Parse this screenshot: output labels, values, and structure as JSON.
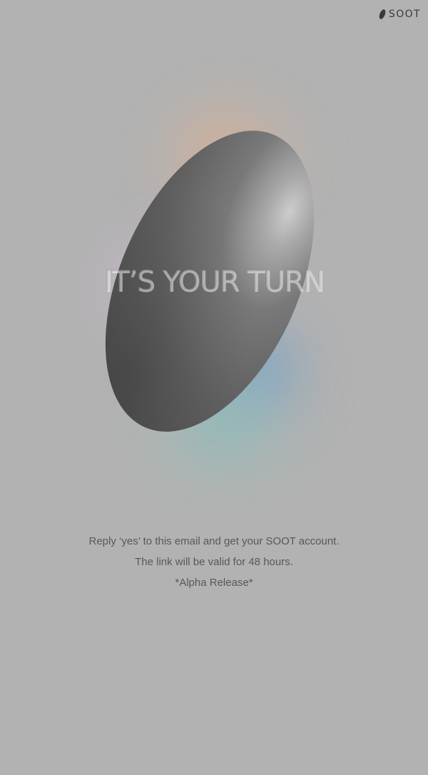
{
  "brand": {
    "name": "SOOT",
    "logo_icon": "soot-bean-icon"
  },
  "hero": {
    "headline": "IT’S YOUR TURN",
    "shape": "grey-bean-shape"
  },
  "message": {
    "line1": "Reply ‘yes’ to this email and get your SOOT account.",
    "line2": "The link will be valid for 48 hours.",
    "line3": "*Alpha Release*"
  },
  "colors": {
    "background": "#b2b2b2",
    "blob": "#5b5b5b",
    "text": "#585858",
    "glow_peach": "#f2a876",
    "glow_pink": "#e2bee2",
    "glow_blue": "#5292d2",
    "glow_teal": "#70bebc"
  }
}
